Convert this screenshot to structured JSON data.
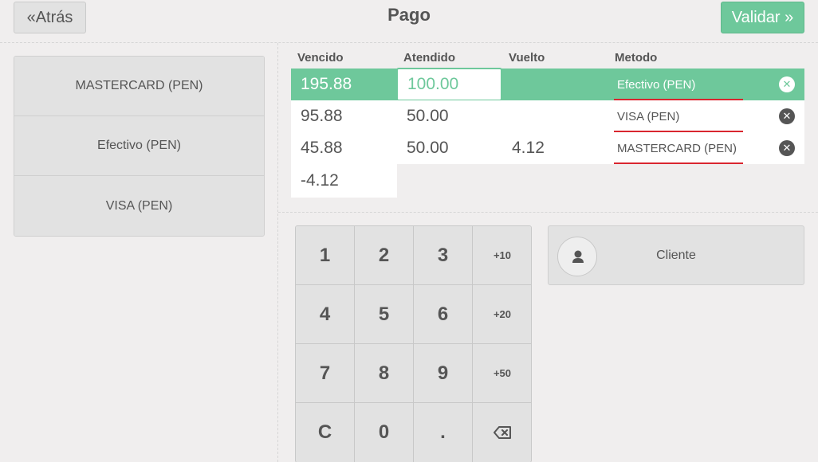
{
  "header": {
    "back_label": "Atrás",
    "title": "Pago",
    "validate_label": "Validar"
  },
  "payment_methods": [
    {
      "label": "MASTERCARD (PEN)"
    },
    {
      "label": "Efectivo (PEN)"
    },
    {
      "label": "VISA (PEN)"
    }
  ],
  "lines": {
    "headers": {
      "due": "Vencido",
      "tendered": "Atendido",
      "change": "Vuelto",
      "method": "Metodo"
    },
    "rows": [
      {
        "due": "195.88",
        "tendered": "100.00",
        "change": "",
        "method": "Efectivo (PEN)",
        "selected": true
      },
      {
        "due": "95.88",
        "tendered": "50.00",
        "change": "",
        "method": "VISA (PEN)",
        "selected": false
      },
      {
        "due": "45.88",
        "tendered": "50.00",
        "change": "4.12",
        "method": "MASTERCARD (PEN)",
        "selected": false
      }
    ],
    "remaining": "-4.12"
  },
  "numpad": {
    "keys": [
      "1",
      "2",
      "3",
      "+10",
      "4",
      "5",
      "6",
      "+20",
      "7",
      "8",
      "9",
      "+50",
      "C",
      "0",
      ".",
      ""
    ]
  },
  "customer": {
    "label": "Cliente"
  },
  "colors": {
    "accent": "#6ec89b",
    "button_bg": "#e2e2e2",
    "text": "#555555",
    "underline": "#d9262f"
  }
}
